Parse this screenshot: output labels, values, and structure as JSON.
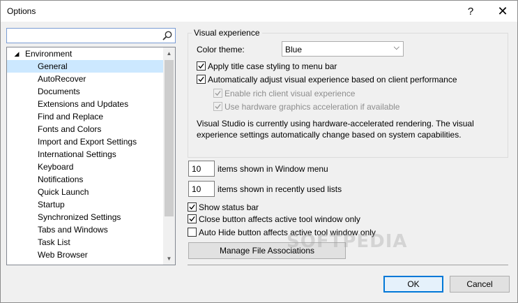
{
  "window": {
    "title": "Options",
    "help_glyph": "?",
    "close_glyph": "✕"
  },
  "search": {
    "value": "",
    "placeholder": ""
  },
  "tree": {
    "root_label": "Environment",
    "items": [
      {
        "label": "General",
        "selected": true
      },
      {
        "label": "AutoRecover"
      },
      {
        "label": "Documents"
      },
      {
        "label": "Extensions and Updates"
      },
      {
        "label": "Find and Replace"
      },
      {
        "label": "Fonts and Colors"
      },
      {
        "label": "Import and Export Settings"
      },
      {
        "label": "International Settings"
      },
      {
        "label": "Keyboard"
      },
      {
        "label": "Notifications"
      },
      {
        "label": "Quick Launch"
      },
      {
        "label": "Startup"
      },
      {
        "label": "Synchronized Settings"
      },
      {
        "label": "Tabs and Windows"
      },
      {
        "label": "Task List"
      },
      {
        "label": "Web Browser"
      }
    ]
  },
  "visual": {
    "group_title": "Visual experience",
    "color_theme_label": "Color theme:",
    "color_theme_value": "Blue",
    "apply_title_case": {
      "label": "Apply title case styling to menu bar",
      "checked": true
    },
    "auto_adjust": {
      "label": "Automatically adjust visual experience based on client performance",
      "checked": true
    },
    "rich_client": {
      "label": "Enable rich client visual experience",
      "checked": true,
      "disabled": true
    },
    "hw_accel": {
      "label": "Use hardware graphics acceleration if available",
      "checked": true,
      "disabled": true
    },
    "info_line1": "Visual Studio is currently using hardware-accelerated rendering. The visual",
    "info_line2": "experience settings automatically change based on system capabilities."
  },
  "window_menu": {
    "value": "10",
    "label": "items shown in Window menu"
  },
  "recent_lists": {
    "value": "10",
    "label": "items shown in recently used lists"
  },
  "status_bar": {
    "label": "Show status bar",
    "checked": true
  },
  "close_button": {
    "label": "Close button affects active tool window only",
    "checked": true
  },
  "auto_hide": {
    "label": "Auto Hide button affects active tool window only",
    "checked": false
  },
  "buttons": {
    "manage_file_assoc": "Manage File Associations",
    "ok": "OK",
    "cancel": "Cancel"
  },
  "watermark": "SOFTPEDIA"
}
